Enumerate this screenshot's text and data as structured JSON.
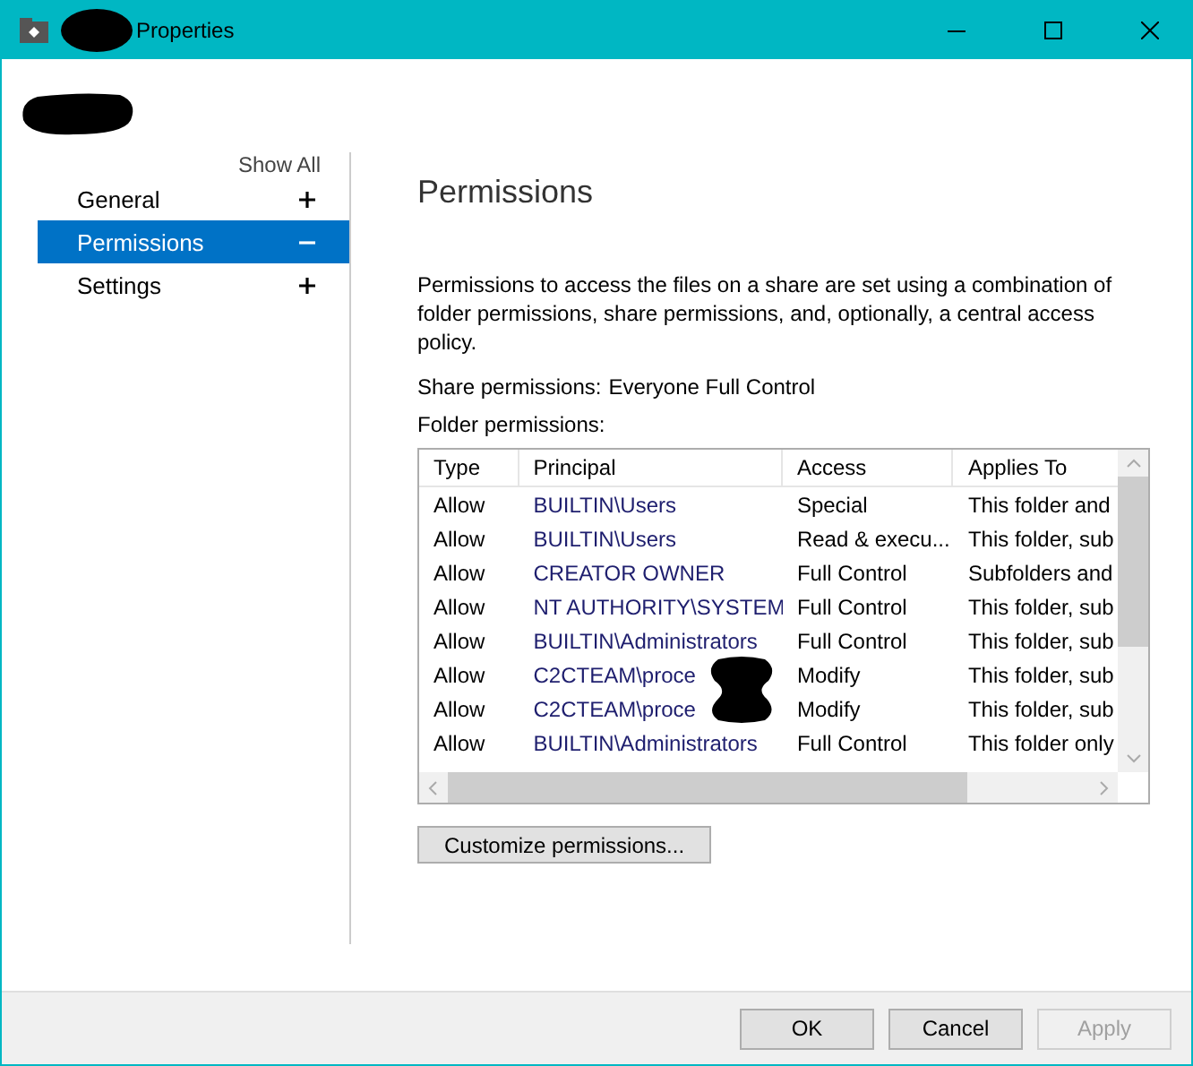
{
  "window": {
    "title": "Properties",
    "buttons": [
      {
        "kind": "minimize"
      },
      {
        "kind": "maximize"
      },
      {
        "kind": "close"
      }
    ]
  },
  "nav": {
    "show_all": "Show All",
    "items": [
      {
        "label": "General",
        "selected": false,
        "expanded": false
      },
      {
        "label": "Permissions",
        "selected": true,
        "expanded": true
      },
      {
        "label": "Settings",
        "selected": false,
        "expanded": false
      }
    ]
  },
  "page": {
    "heading": "Permissions",
    "description": "Permissions to access the files on a share are set using a combination of folder permissions, share permissions, and, optionally, a central access policy.",
    "share_permissions": {
      "label": "Share permissions:",
      "value": "Everyone Full Control"
    },
    "folder_permissions_label": "Folder permissions:",
    "table": {
      "columns": [
        "Type",
        "Principal",
        "Access",
        "Applies To"
      ],
      "rows": [
        [
          "Allow",
          "BUILTIN\\Users",
          "Special",
          "This folder and"
        ],
        [
          "Allow",
          "BUILTIN\\Users",
          "Read & execu...",
          "This folder, sub"
        ],
        [
          "Allow",
          "CREATOR OWNER",
          "Full Control",
          "Subfolders and"
        ],
        [
          "Allow",
          "NT AUTHORITY\\SYSTEM",
          "Full Control",
          "This folder, sub"
        ],
        [
          "Allow",
          "BUILTIN\\Administrators",
          "Full Control",
          "This folder, sub"
        ],
        [
          "Allow",
          "C2CTEAM\\proce",
          "Modify",
          "This folder, sub"
        ],
        [
          "Allow",
          "C2CTEAM\\proce",
          "Modify",
          "This folder, sub"
        ],
        [
          "Allow",
          "BUILTIN\\Administrators",
          "Full Control",
          "This folder only"
        ]
      ]
    },
    "customize_button": "Customize permissions..."
  },
  "footer": {
    "buttons": [
      {
        "label": "OK",
        "disabled": false
      },
      {
        "label": "Cancel",
        "disabled": false
      },
      {
        "label": "Apply",
        "disabled": true
      }
    ]
  }
}
